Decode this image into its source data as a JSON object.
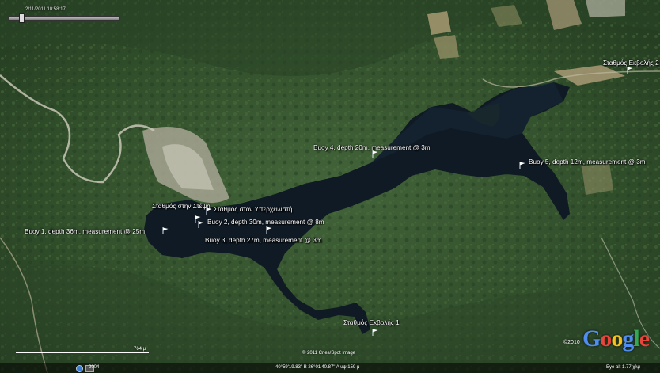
{
  "timeline": {
    "date": "2/11/2011 10:58:17"
  },
  "placemarks": [
    {
      "id": "buoy-1",
      "label": "Buoy 1, depth 36m, measurement @ 25m"
    },
    {
      "id": "buoy-2",
      "label": "Buoy 2, depth 30m, measurement @ 8m"
    },
    {
      "id": "buoy-3",
      "label": "Buoy 3, depth 27m, measurement @ 3m"
    },
    {
      "id": "buoy-4",
      "label": "Buoy 4, depth 20m, measurement @ 3m"
    },
    {
      "id": "buoy-5",
      "label": "Buoy 5, depth 12m, measurement @ 3m"
    },
    {
      "id": "station-stefi",
      "label": "Σταθμός στην Στέψη"
    },
    {
      "id": "station-overflow",
      "label": "Σταθμός στον Υπερχειλιστή"
    },
    {
      "id": "outlet-station-1",
      "label": "Σταθμός Εκβολής 1"
    },
    {
      "id": "outlet-station-2",
      "label": "Σταθμός Εκβολής 2"
    }
  ],
  "scale": {
    "label": "764 μ"
  },
  "imagery_credit": "© 2011 Cnes/Spot Image",
  "copyright": "©2010",
  "logo": "Google",
  "status": {
    "year": "2004",
    "coordinates": "40°59'19.83\" B  26°01'40.87\" A  υψ  159 μ",
    "eye_alt": "Eye alt  1.77 χλμ"
  },
  "colors": {
    "water": "#0f1a24",
    "vegetation": "#3a5a2c",
    "flag": "#ffffff",
    "label": "#ffffff"
  }
}
